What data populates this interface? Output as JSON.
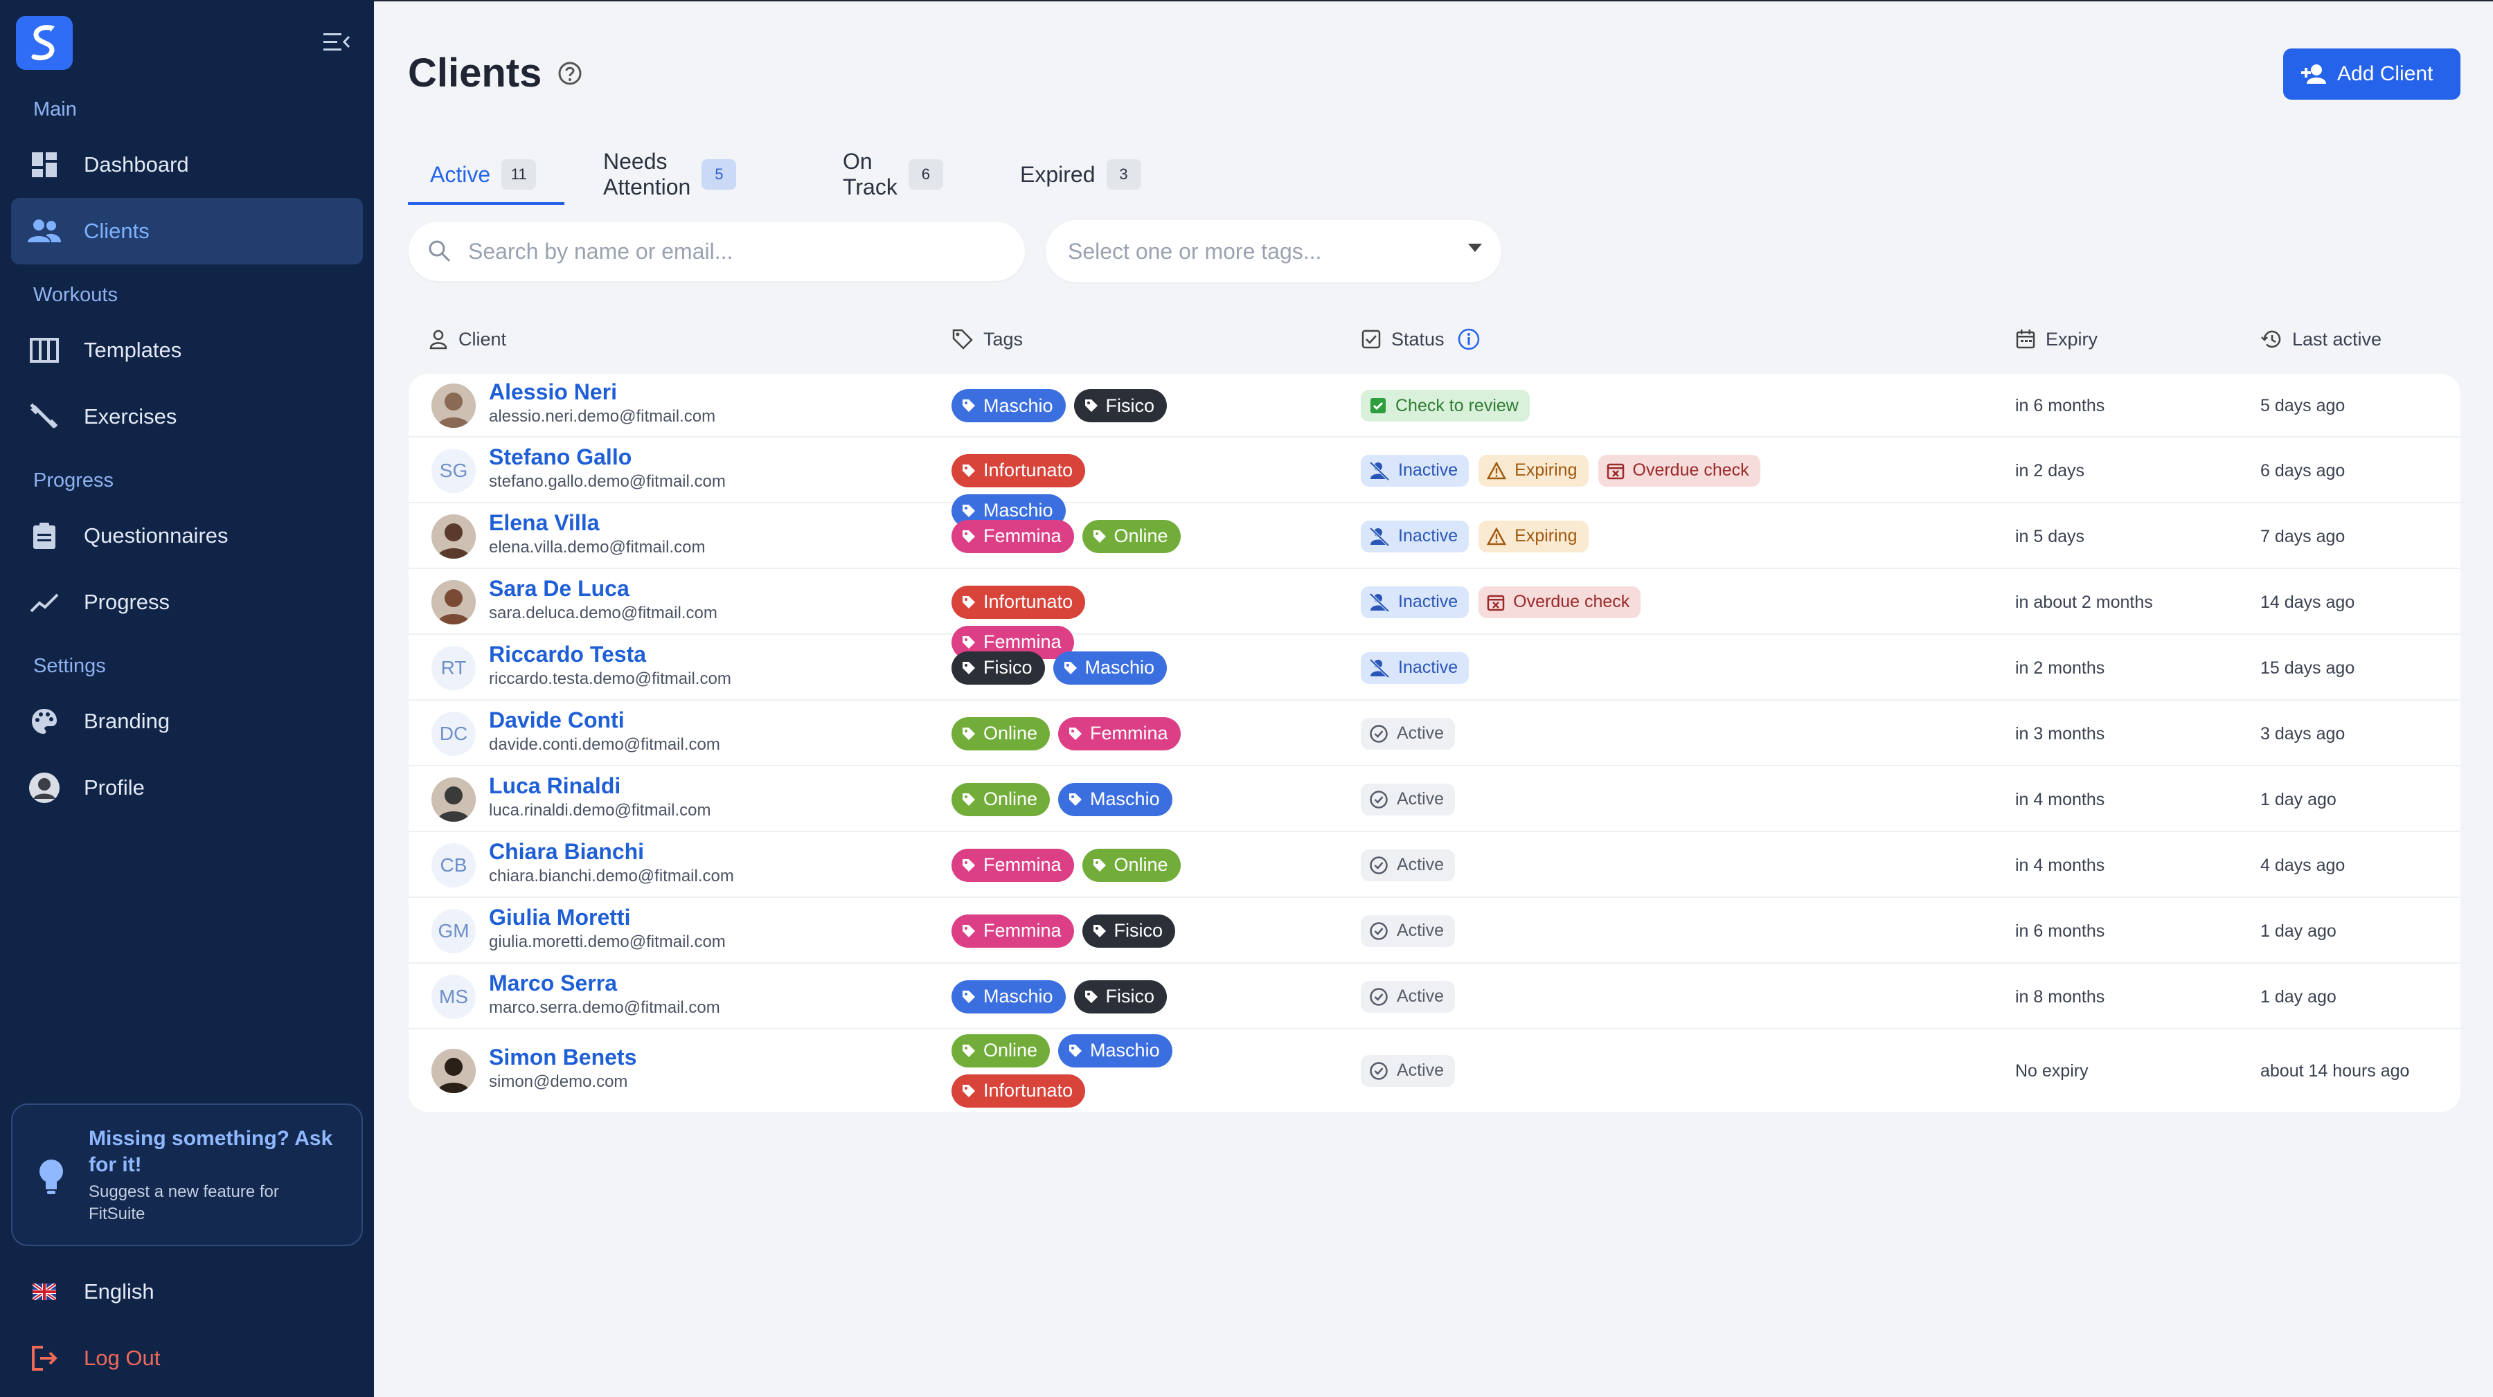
{
  "app": {
    "name": "FitSuite",
    "accent": "#2563eb",
    "sidebar_bg": "#102447"
  },
  "sidebar": {
    "sections": [
      {
        "label": "Main"
      },
      {
        "label": "Workouts"
      },
      {
        "label": "Progress"
      },
      {
        "label": "Settings"
      }
    ],
    "items": [
      {
        "label": "Dashboard",
        "icon": "dashboard-icon"
      },
      {
        "label": "Clients",
        "icon": "people-icon",
        "active": true
      },
      {
        "label": "Templates",
        "icon": "columns-icon"
      },
      {
        "label": "Exercises",
        "icon": "dumbbell-icon"
      },
      {
        "label": "Questionnaires",
        "icon": "clipboard-icon"
      },
      {
        "label": "Progress",
        "icon": "trend-icon"
      },
      {
        "label": "Branding",
        "icon": "palette-icon"
      },
      {
        "label": "Profile",
        "icon": "profile-avatar"
      }
    ],
    "suggest": {
      "title": "Missing something? Ask for it!",
      "subtitle": "Suggest a new feature for FitSuite"
    },
    "language": "English",
    "logout": "Log Out"
  },
  "header": {
    "title": "Clients",
    "add_button": "Add Client"
  },
  "tabs": [
    {
      "label": "Active",
      "count": "11",
      "active": true
    },
    {
      "label": "Needs Attention",
      "count": "5"
    },
    {
      "label": "On Track",
      "count": "6"
    },
    {
      "label": "Expired",
      "count": "3"
    }
  ],
  "filters": {
    "search_placeholder": "Search by name or email...",
    "tags_placeholder": "Select one or more tags..."
  },
  "table": {
    "columns": {
      "client": "Client",
      "tags": "Tags",
      "status": "Status",
      "expiry": "Expiry",
      "last_active": "Last active"
    },
    "tag_colors": {
      "Maschio": "#3b6fe0",
      "Fisico": "#2b2f38",
      "Infortunato": "#d8433a",
      "Femmina": "#dc3f86",
      "Online": "#72ad3a"
    },
    "rows": [
      {
        "name": "Alessio Neri",
        "email": "alessio.neri.demo@fitmail.com",
        "avatar": "photo",
        "tags": [
          "Maschio",
          "Fisico"
        ],
        "status": [
          {
            "label": "Check to review",
            "kind": "review"
          }
        ],
        "expiry": "in 6 months",
        "last_active": "5 days ago"
      },
      {
        "name": "Stefano Gallo",
        "email": "stefano.gallo.demo@fitmail.com",
        "avatar": "SG",
        "tags": [
          "Infortunato",
          "Maschio"
        ],
        "status": [
          {
            "label": "Inactive",
            "kind": "inactive"
          },
          {
            "label": "Expiring",
            "kind": "expiring"
          },
          {
            "label": "Overdue check",
            "kind": "overdue"
          }
        ],
        "expiry": "in 2 days",
        "last_active": "6 days ago"
      },
      {
        "name": "Elena Villa",
        "email": "elena.villa.demo@fitmail.com",
        "avatar": "photo",
        "tags": [
          "Femmina",
          "Online"
        ],
        "status": [
          {
            "label": "Inactive",
            "kind": "inactive"
          },
          {
            "label": "Expiring",
            "kind": "expiring"
          }
        ],
        "expiry": "in 5 days",
        "last_active": "7 days ago"
      },
      {
        "name": "Sara De Luca",
        "email": "sara.deluca.demo@fitmail.com",
        "avatar": "photo",
        "tags": [
          "Infortunato",
          "Femmina"
        ],
        "status": [
          {
            "label": "Inactive",
            "kind": "inactive"
          },
          {
            "label": "Overdue check",
            "kind": "overdue"
          }
        ],
        "expiry": "in about 2 months",
        "last_active": "14 days ago"
      },
      {
        "name": "Riccardo Testa",
        "email": "riccardo.testa.demo@fitmail.com",
        "avatar": "RT",
        "tags": [
          "Fisico",
          "Maschio"
        ],
        "status": [
          {
            "label": "Inactive",
            "kind": "inactive"
          }
        ],
        "expiry": "in 2 months",
        "last_active": "15 days ago"
      },
      {
        "name": "Davide Conti",
        "email": "davide.conti.demo@fitmail.com",
        "avatar": "DC",
        "tags": [
          "Online",
          "Femmina"
        ],
        "status": [
          {
            "label": "Active",
            "kind": "active"
          }
        ],
        "expiry": "in 3 months",
        "last_active": "3 days ago"
      },
      {
        "name": "Luca Rinaldi",
        "email": "luca.rinaldi.demo@fitmail.com",
        "avatar": "photo",
        "tags": [
          "Online",
          "Maschio"
        ],
        "status": [
          {
            "label": "Active",
            "kind": "active"
          }
        ],
        "expiry": "in 4 months",
        "last_active": "1 day ago"
      },
      {
        "name": "Chiara Bianchi",
        "email": "chiara.bianchi.demo@fitmail.com",
        "avatar": "CB",
        "tags": [
          "Femmina",
          "Online"
        ],
        "status": [
          {
            "label": "Active",
            "kind": "active"
          }
        ],
        "expiry": "in 4 months",
        "last_active": "4 days ago"
      },
      {
        "name": "Giulia Moretti",
        "email": "giulia.moretti.demo@fitmail.com",
        "avatar": "GM",
        "tags": [
          "Femmina",
          "Fisico"
        ],
        "status": [
          {
            "label": "Active",
            "kind": "active"
          }
        ],
        "expiry": "in 6 months",
        "last_active": "1 day ago"
      },
      {
        "name": "Marco Serra",
        "email": "marco.serra.demo@fitmail.com",
        "avatar": "MS",
        "tags": [
          "Maschio",
          "Fisico"
        ],
        "status": [
          {
            "label": "Active",
            "kind": "active"
          }
        ],
        "expiry": "in 8 months",
        "last_active": "1 day ago"
      },
      {
        "name": "Simon Benets",
        "email": "simon@demo.com",
        "avatar": "photo",
        "tags": [
          "Online",
          "Maschio",
          "Infortunato"
        ],
        "status": [
          {
            "label": "Active",
            "kind": "active"
          }
        ],
        "expiry": "No expiry",
        "last_active": "about 14 hours ago"
      }
    ]
  }
}
